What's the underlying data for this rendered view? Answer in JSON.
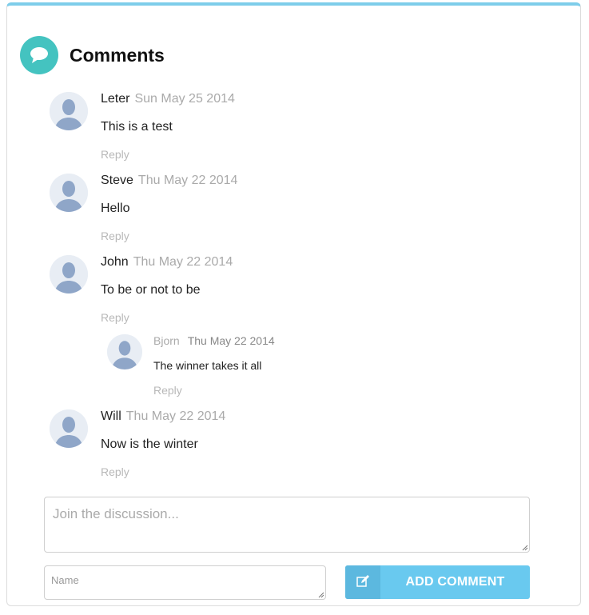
{
  "header": {
    "title": "Comments",
    "icon": "speech-bubble-icon"
  },
  "comments": [
    {
      "author": "Leter",
      "date": "Sun May 25 2014",
      "text": "This is a test",
      "reply_label": "Reply"
    },
    {
      "author": "Steve",
      "date": "Thu May 22 2014",
      "text": "Hello",
      "reply_label": "Reply"
    },
    {
      "author": "John",
      "date": "Thu May 22 2014",
      "text": "To be or not to be",
      "reply_label": "Reply",
      "replies": [
        {
          "author": "Bjorn",
          "date": "Thu May 22 2014",
          "text": "The winner takes it all",
          "reply_label": "Reply"
        }
      ]
    },
    {
      "author": "Will",
      "date": "Thu May 22 2014",
      "text": "Now is the winter",
      "reply_label": "Reply"
    }
  ],
  "form": {
    "comment_placeholder": "Join the discussion...",
    "name_placeholder": "Name",
    "submit_label": "ADD COMMENT",
    "submit_icon": "edit-icon"
  },
  "colors": {
    "accent_top_border": "#7ecdea",
    "header_icon_bg": "#44c3c0",
    "button_bg": "#69c9ef",
    "avatar_bg": "#e8edf4",
    "avatar_fg": "#8fa6c8"
  }
}
